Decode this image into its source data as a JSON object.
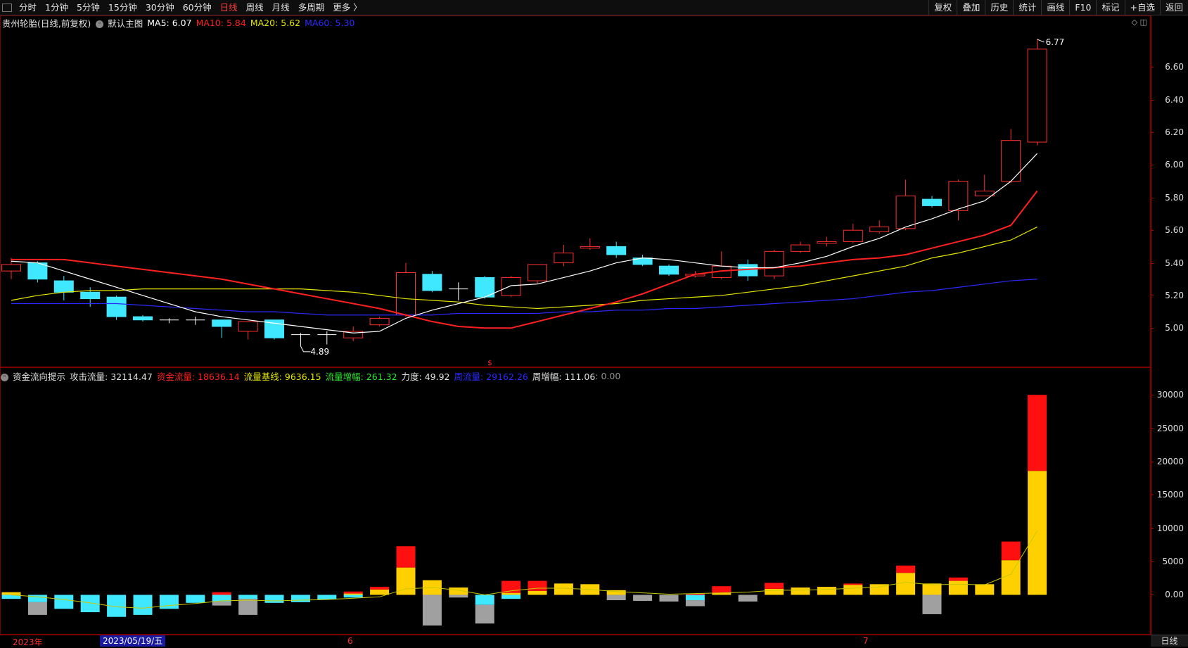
{
  "toolbar": {
    "left": [
      "分时",
      "1分钟",
      "5分钟",
      "15分钟",
      "30分钟",
      "60分钟",
      "日线",
      "周线",
      "月线",
      "多周期",
      "更多 〉"
    ],
    "active": "日线",
    "right": [
      "复权",
      "叠加",
      "历史",
      "统计",
      "画线",
      "F10",
      "标记",
      "+自选",
      "返回"
    ]
  },
  "main_info": {
    "stock": "贵州轮胎(日线,前复权)",
    "template": "默认主图",
    "ma5": "MA5: 6.07",
    "ma10": "MA10: 5.84",
    "ma20": "MA20: 5.62",
    "ma60": "MA60: 5.30",
    "ma5_color": "#ffffff",
    "ma10_color": "#ff2020",
    "ma20_color": "#e6e600",
    "ma60_color": "#2a2aff"
  },
  "sub_info": {
    "name": "资金流向提示",
    "attack": "攻击流量: 32114.47",
    "fund": "资金流量: 18636.14",
    "base": "流量基线: 9636.15",
    "gain": "流量增幅: 261.32",
    "force": "力度: 49.92",
    "week_flow": "周流量: 29162.26",
    "week_gain": "周增幅: 111.06",
    "tail": ": 0.00"
  },
  "price_axis": {
    "ticks": [
      "6.60",
      "6.40",
      "6.20",
      "6.00",
      "5.80",
      "5.60",
      "5.40",
      "5.20",
      "5.00"
    ],
    "min": 4.79,
    "max": 6.83
  },
  "volume_axis": {
    "ticks": [
      "30000",
      "25000",
      "20000",
      "15000",
      "10000",
      "5000",
      "0.00"
    ],
    "min": -4700,
    "max": 31500
  },
  "annotations": {
    "high": "6.77",
    "low": "4.89"
  },
  "bottom": {
    "year": "2023年",
    "cursor_date": "2023/05/19/五",
    "month6": "6",
    "month7": "7",
    "period": "日线"
  },
  "chart_data": [
    {
      "type": "candlestick",
      "candles": [
        {
          "o": 5.35,
          "h": 5.43,
          "l": 5.3,
          "c": 5.39
        },
        {
          "o": 5.4,
          "h": 5.41,
          "l": 5.28,
          "c": 5.3
        },
        {
          "o": 5.29,
          "h": 5.32,
          "l": 5.17,
          "c": 5.22
        },
        {
          "o": 5.22,
          "h": 5.25,
          "l": 5.13,
          "c": 5.18
        },
        {
          "o": 5.19,
          "h": 5.2,
          "l": 5.05,
          "c": 5.07
        },
        {
          "o": 5.07,
          "h": 5.08,
          "l": 5.04,
          "c": 5.05
        },
        {
          "o": 5.05,
          "h": 5.06,
          "l": 5.03,
          "c": 5.05
        },
        {
          "o": 5.05,
          "h": 5.07,
          "l": 5.02,
          "c": 5.05
        },
        {
          "o": 5.05,
          "h": 5.05,
          "l": 4.94,
          "c": 5.01
        },
        {
          "o": 4.98,
          "h": 5.04,
          "l": 4.93,
          "c": 5.04
        },
        {
          "o": 5.05,
          "h": 5.05,
          "l": 4.93,
          "c": 4.94
        },
        {
          "o": 4.96,
          "h": 4.97,
          "l": 4.89,
          "c": 4.96
        },
        {
          "o": 4.96,
          "h": 4.98,
          "l": 4.9,
          "c": 4.96
        },
        {
          "o": 4.94,
          "h": 5.01,
          "l": 4.92,
          "c": 4.98
        },
        {
          "o": 5.02,
          "h": 5.07,
          "l": 5.01,
          "c": 5.06
        },
        {
          "o": 5.08,
          "h": 5.4,
          "l": 5.07,
          "c": 5.34
        },
        {
          "o": 5.33,
          "h": 5.35,
          "l": 5.22,
          "c": 5.23
        },
        {
          "o": 5.24,
          "h": 5.28,
          "l": 5.17,
          "c": 5.24
        },
        {
          "o": 5.31,
          "h": 5.32,
          "l": 5.18,
          "c": 5.19
        },
        {
          "o": 5.2,
          "h": 5.32,
          "l": 5.19,
          "c": 5.31
        },
        {
          "o": 5.29,
          "h": 5.39,
          "l": 5.27,
          "c": 5.39
        },
        {
          "o": 5.4,
          "h": 5.51,
          "l": 5.38,
          "c": 5.46
        },
        {
          "o": 5.49,
          "h": 5.55,
          "l": 5.48,
          "c": 5.5
        },
        {
          "o": 5.5,
          "h": 5.53,
          "l": 5.43,
          "c": 5.45
        },
        {
          "o": 5.43,
          "h": 5.45,
          "l": 5.38,
          "c": 5.39
        },
        {
          "o": 5.38,
          "h": 5.39,
          "l": 5.32,
          "c": 5.33
        },
        {
          "o": 5.32,
          "h": 5.35,
          "l": 5.31,
          "c": 5.33
        },
        {
          "o": 5.31,
          "h": 5.47,
          "l": 5.3,
          "c": 5.38
        },
        {
          "o": 5.39,
          "h": 5.42,
          "l": 5.29,
          "c": 5.32
        },
        {
          "o": 5.32,
          "h": 5.48,
          "l": 5.3,
          "c": 5.47
        },
        {
          "o": 5.47,
          "h": 5.53,
          "l": 5.46,
          "c": 5.51
        },
        {
          "o": 5.52,
          "h": 5.56,
          "l": 5.5,
          "c": 5.53
        },
        {
          "o": 5.53,
          "h": 5.64,
          "l": 5.52,
          "c": 5.6
        },
        {
          "o": 5.59,
          "h": 5.66,
          "l": 5.58,
          "c": 5.62
        },
        {
          "o": 5.61,
          "h": 5.91,
          "l": 5.6,
          "c": 5.81
        },
        {
          "o": 5.79,
          "h": 5.81,
          "l": 5.74,
          "c": 5.75
        },
        {
          "o": 5.72,
          "h": 5.91,
          "l": 5.66,
          "c": 5.9
        },
        {
          "o": 5.81,
          "h": 5.94,
          "l": 5.81,
          "c": 5.84
        },
        {
          "o": 5.9,
          "h": 6.22,
          "l": 5.89,
          "c": 6.15
        },
        {
          "o": 6.14,
          "h": 6.77,
          "l": 6.12,
          "c": 6.71
        }
      ],
      "ma5": [
        5.41,
        5.4,
        5.35,
        5.3,
        5.25,
        5.2,
        5.15,
        5.1,
        5.07,
        5.05,
        5.03,
        5.01,
        4.99,
        4.97,
        4.98,
        5.06,
        5.11,
        5.15,
        5.19,
        5.26,
        5.27,
        5.31,
        5.35,
        5.4,
        5.43,
        5.42,
        5.4,
        5.38,
        5.37,
        5.37,
        5.4,
        5.44,
        5.5,
        5.55,
        5.62,
        5.67,
        5.73,
        5.78,
        5.9,
        6.07
      ],
      "ma10": [
        5.42,
        5.42,
        5.42,
        5.4,
        5.38,
        5.36,
        5.34,
        5.32,
        5.3,
        5.27,
        5.24,
        5.21,
        5.18,
        5.15,
        5.12,
        5.08,
        5.04,
        5.01,
        5.0,
        5.0,
        5.04,
        5.08,
        5.12,
        5.16,
        5.21,
        5.27,
        5.33,
        5.35,
        5.36,
        5.37,
        5.38,
        5.4,
        5.42,
        5.43,
        5.45,
        5.49,
        5.53,
        5.57,
        5.63,
        5.84
      ],
      "ma20": [
        5.17,
        5.2,
        5.22,
        5.23,
        5.23,
        5.24,
        5.24,
        5.24,
        5.24,
        5.24,
        5.24,
        5.24,
        5.23,
        5.22,
        5.2,
        5.18,
        5.17,
        5.16,
        5.14,
        5.13,
        5.12,
        5.13,
        5.14,
        5.15,
        5.17,
        5.18,
        5.19,
        5.2,
        5.22,
        5.24,
        5.26,
        5.29,
        5.32,
        5.35,
        5.38,
        5.43,
        5.46,
        5.5,
        5.54,
        5.62
      ],
      "ma60": [
        5.15,
        5.15,
        5.15,
        5.15,
        5.15,
        5.14,
        5.13,
        5.12,
        5.11,
        5.1,
        5.1,
        5.09,
        5.08,
        5.08,
        5.08,
        5.08,
        5.08,
        5.09,
        5.09,
        5.09,
        5.09,
        5.1,
        5.1,
        5.11,
        5.11,
        5.12,
        5.12,
        5.13,
        5.14,
        5.15,
        5.16,
        5.17,
        5.18,
        5.2,
        5.22,
        5.23,
        5.25,
        5.27,
        5.29,
        5.3
      ],
      "colors": {
        "up": "#ff3030",
        "down": "#40e8ff",
        "cross": "#ffffff"
      }
    },
    {
      "type": "bar",
      "positive_yellow": [
        400,
        0,
        0,
        0,
        0,
        0,
        0,
        0,
        0,
        0,
        0,
        0,
        0,
        200,
        800,
        4100,
        2200,
        1100,
        0,
        300,
        600,
        1700,
        1600,
        700,
        0,
        0,
        0,
        300,
        0,
        900,
        1100,
        1200,
        1500,
        1600,
        3300,
        1700,
        2100,
        1600,
        5200,
        18600
      ],
      "positive_red": [
        0,
        0,
        0,
        0,
        0,
        0,
        0,
        0,
        400,
        0,
        0,
        0,
        0,
        300,
        400,
        3200,
        0,
        0,
        0,
        1800,
        1500,
        0,
        0,
        0,
        0,
        0,
        200,
        1000,
        0,
        900,
        0,
        0,
        200,
        0,
        1100,
        0,
        500,
        0,
        2800,
        11400
      ],
      "negative_cyan": [
        -600,
        -1100,
        -2100,
        -2600,
        -3300,
        -3000,
        -2100,
        -1200,
        -1000,
        -600,
        -1200,
        -1100,
        -700,
        -400,
        0,
        0,
        0,
        0,
        -1500,
        -600,
        0,
        0,
        0,
        0,
        0,
        0,
        -800,
        0,
        0,
        0,
        0,
        0,
        0,
        0,
        0,
        0,
        0,
        0,
        0,
        0
      ],
      "negative_gray": [
        0,
        -1900,
        0,
        0,
        0,
        0,
        0,
        0,
        -600,
        -2400,
        0,
        0,
        0,
        0,
        0,
        0,
        -4600,
        -400,
        -2800,
        0,
        0,
        0,
        0,
        -800,
        -900,
        -1000,
        -900,
        0,
        -1000,
        0,
        0,
        0,
        0,
        0,
        0,
        -2900,
        0,
        0,
        0,
        0
      ],
      "baseline": [
        0,
        -300,
        -700,
        -1200,
        -1800,
        -2000,
        -1600,
        -1300,
        -900,
        -800,
        -900,
        -800,
        -700,
        -500,
        -300,
        900,
        1100,
        700,
        0,
        600,
        1000,
        1000,
        800,
        500,
        300,
        100,
        200,
        300,
        400,
        700,
        700,
        800,
        1000,
        1200,
        1900,
        1500,
        1600,
        1500,
        3100,
        9600
      ],
      "colors": {
        "yellow": "#ffd000",
        "red": "#ff1010",
        "cyan": "#40e8ff",
        "gray": "#a0a0a0",
        "baseline": "#c8c800"
      }
    }
  ]
}
